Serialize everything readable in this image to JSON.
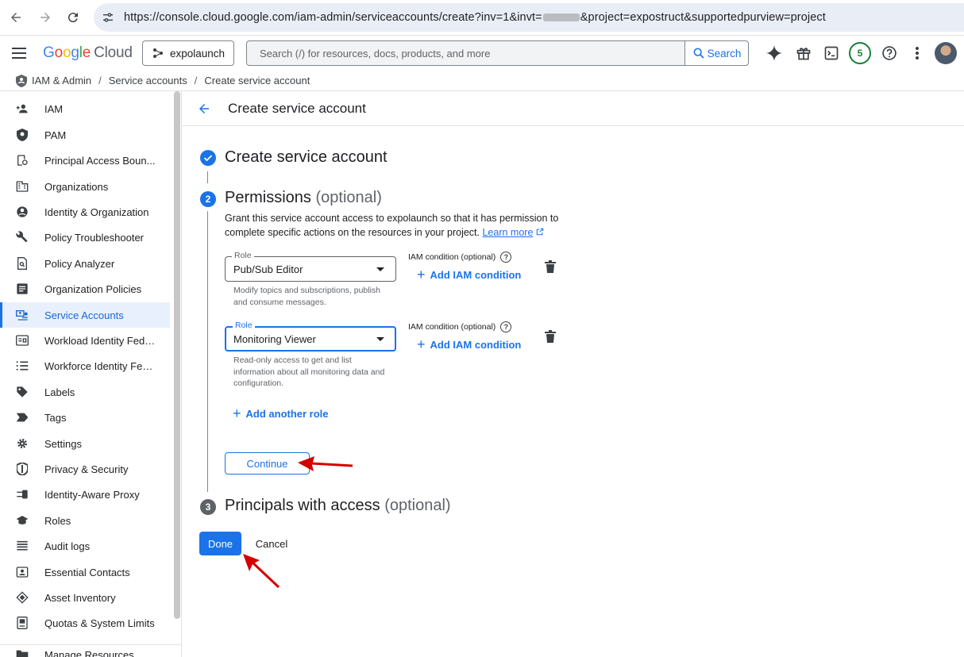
{
  "browser": {
    "url_before_mask": "https://console.cloud.google.com/iam-admin/serviceaccounts/create?inv=1&invt=",
    "url_after_mask": "&project=expostruct&supportedpurview=project"
  },
  "header": {
    "logo_google": [
      "G",
      "o",
      "o",
      "g",
      "l",
      "e"
    ],
    "logo_cloud": "Cloud",
    "project_name": "expolaunch",
    "search_placeholder": "Search (/) for resources, docs, products, and more",
    "search_button": "Search",
    "notification_count": "5"
  },
  "breadcrumb": {
    "items": [
      "IAM & Admin",
      "Service accounts",
      "Create service account"
    ],
    "separator": "/"
  },
  "sidebar": {
    "items": [
      {
        "label": "IAM",
        "icon": "person-add-icon"
      },
      {
        "label": "PAM",
        "icon": "shield-icon"
      },
      {
        "label": "Principal Access Boun...",
        "icon": "policy-boundary-icon"
      },
      {
        "label": "Organizations",
        "icon": "building-icon"
      },
      {
        "label": "Identity & Organization",
        "icon": "account-circle-icon"
      },
      {
        "label": "Policy Troubleshooter",
        "icon": "wrench-icon"
      },
      {
        "label": "Policy Analyzer",
        "icon": "document-search-icon"
      },
      {
        "label": "Organization Policies",
        "icon": "list-box-icon"
      },
      {
        "label": "Service Accounts",
        "icon": "service-account-icon"
      },
      {
        "label": "Workload Identity Fede...",
        "icon": "id-card-icon"
      },
      {
        "label": "Workforce Identity Fed...",
        "icon": "list-icon"
      },
      {
        "label": "Labels",
        "icon": "tag-icon"
      },
      {
        "label": "Tags",
        "icon": "arrow-tag-icon"
      },
      {
        "label": "Settings",
        "icon": "gear-icon"
      },
      {
        "label": "Privacy & Security",
        "icon": "privacy-shield-icon"
      },
      {
        "label": "Identity-Aware Proxy",
        "icon": "proxy-icon"
      },
      {
        "label": "Roles",
        "icon": "hat-icon"
      },
      {
        "label": "Audit logs",
        "icon": "lines-icon"
      },
      {
        "label": "Essential Contacts",
        "icon": "contact-card-icon"
      },
      {
        "label": "Asset Inventory",
        "icon": "diamond-icon"
      },
      {
        "label": "Quotas & System Limits",
        "icon": "quota-icon"
      },
      {
        "label": "Manage Resources",
        "icon": "folder-icon"
      }
    ],
    "active_index": 8
  },
  "main": {
    "page_title": "Create service account",
    "step1_title": "Create service account",
    "step2_number": "2",
    "step2_title": "Permissions",
    "step2_optional": "(optional)",
    "step2_desc": "Grant this service account access to expolaunch so that it has permission to complete specific actions on the resources in your project.",
    "learn_more": "Learn more",
    "role_label": "Role",
    "iam_condition_label": "IAM condition (optional)",
    "add_iam_condition": "Add IAM condition",
    "roles": [
      {
        "value": "Pub/Sub Editor",
        "help": "Modify topics and subscriptions, publish and consume messages."
      },
      {
        "value": "Monitoring Viewer",
        "help": "Read-only access to get and list information about all monitoring data and configuration."
      }
    ],
    "add_another_role": "Add another role",
    "continue_button": "Continue",
    "step3_number": "3",
    "step3_title": "Principals with access",
    "step3_optional": "(optional)",
    "done_button": "Done",
    "cancel_button": "Cancel"
  },
  "colors": {
    "accent": "#1a73e8",
    "annotation_arrow": "#d40000",
    "step_complete": "#1a73e8",
    "step_pending": "#5f6368"
  }
}
